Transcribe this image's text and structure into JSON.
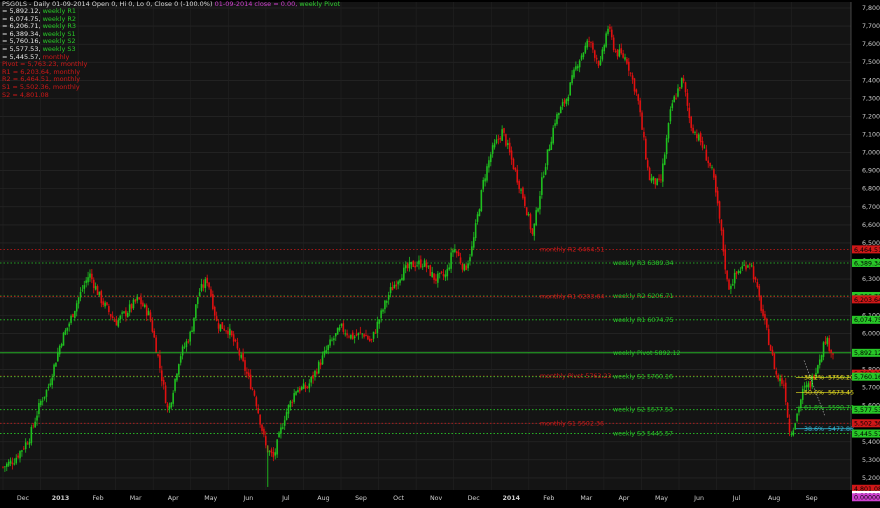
{
  "header": {
    "symbol_line": "PSG0LS - Daily 01-09-2014 Open 0, Hi 0, Lo 0, Close 0 (-100.0%)",
    "close_line": "01-09-2014 close = 0.00,",
    "pivot_line": "weekly Pivot"
  },
  "legend": [
    {
      "value": "= 5,892.12,",
      "label": "weekly R1",
      "color": "#28c828"
    },
    {
      "value": "= 6,074.75,",
      "label": "weekly R2",
      "color": "#28c828"
    },
    {
      "value": "= 6,206.71,",
      "label": "weekly R3",
      "color": "#28c828"
    },
    {
      "value": "= 6,389.34,",
      "label": "weekly S1",
      "color": "#28c828"
    },
    {
      "value": "= 5,760.16,",
      "label": "weekly S2",
      "color": "#28c828"
    },
    {
      "value": "= 5,577.53,",
      "label": "weekly S3",
      "color": "#28c828"
    },
    {
      "value": "= 5,445.57,",
      "label": "monthly",
      "color": "#d01818"
    },
    {
      "value": "Pivot = 5,763.23,",
      "label": "monthly",
      "color": "#d01818"
    },
    {
      "value": "R1 = 6,203.64,",
      "label": "monthly",
      "color": "#d01818"
    },
    {
      "value": "R2 = 6,464.51,",
      "label": "monthly",
      "color": "#d01818"
    },
    {
      "value": "S1 = 5,502.36,",
      "label": "monthly",
      "color": "#d01818"
    },
    {
      "value": "S2 = 4,801.08",
      "label": "",
      "color": "#d01818"
    }
  ],
  "chart_data": {
    "type": "candlestick",
    "ylim": [
      5100,
      7800
    ],
    "y_ticks": [
      "5,200",
      "5,300",
      "5,400",
      "5,500",
      "5,600",
      "5,700",
      "5,800",
      "5,900",
      "6,000",
      "6,100",
      "6,200",
      "6,300",
      "6,400",
      "6,500",
      "6,600",
      "6,700",
      "6,800",
      "6,900",
      "7,000",
      "7,100",
      "7,200",
      "7,300",
      "7,400",
      "7,500",
      "7,600",
      "7,700",
      "7,800"
    ],
    "x_labels": [
      "Dec",
      "2013",
      "Feb",
      "Mar",
      "Apr",
      "May",
      "Jun",
      "Jul",
      "Aug",
      "Sep",
      "Oct",
      "Nov",
      "Dec",
      "2014",
      "Feb",
      "Mar",
      "Apr",
      "May",
      "Jun",
      "Jul",
      "Aug",
      "Sep"
    ],
    "bold_x_labels": [
      "2013",
      "2014"
    ],
    "price_path": [
      [
        0,
        5260
      ],
      [
        0.3,
        5300
      ],
      [
        0.7,
        5420
      ],
      [
        1.0,
        5620
      ],
      [
        1.2,
        5700
      ],
      [
        1.55,
        5960
      ],
      [
        1.75,
        6050
      ],
      [
        2.0,
        6190
      ],
      [
        2.3,
        6330
      ],
      [
        2.6,
        6190
      ],
      [
        3.0,
        6060
      ],
      [
        3.3,
        6120
      ],
      [
        3.6,
        6190
      ],
      [
        3.9,
        6100
      ],
      [
        4.1,
        5900
      ],
      [
        4.4,
        5560
      ],
      [
        4.7,
        5870
      ],
      [
        5.0,
        6000
      ],
      [
        5.2,
        6220
      ],
      [
        5.45,
        6300
      ],
      [
        5.7,
        6050
      ],
      [
        6.0,
        6020
      ],
      [
        6.3,
        5880
      ],
      [
        6.7,
        5660
      ],
      [
        7.0,
        5370
      ],
      [
        7.2,
        5310
      ],
      [
        7.5,
        5540
      ],
      [
        7.8,
        5690
      ],
      [
        8.1,
        5700
      ],
      [
        8.4,
        5820
      ],
      [
        8.7,
        5940
      ],
      [
        9.0,
        6030
      ],
      [
        9.3,
        5980
      ],
      [
        9.6,
        6000
      ],
      [
        9.8,
        5950
      ],
      [
        10.0,
        6070
      ],
      [
        10.3,
        6230
      ],
      [
        10.6,
        6330
      ],
      [
        10.9,
        6380
      ],
      [
        11.2,
        6390
      ],
      [
        11.5,
        6300
      ],
      [
        11.8,
        6320
      ],
      [
        12.0,
        6480
      ],
      [
        12.3,
        6350
      ],
      [
        12.5,
        6480
      ],
      [
        12.8,
        6850
      ],
      [
        13.0,
        7000
      ],
      [
        13.3,
        7120
      ],
      [
        13.6,
        6920
      ],
      [
        13.9,
        6720
      ],
      [
        14.1,
        6540
      ],
      [
        14.4,
        6900
      ],
      [
        14.7,
        7180
      ],
      [
        15.0,
        7300
      ],
      [
        15.3,
        7500
      ],
      [
        15.6,
        7620
      ],
      [
        15.9,
        7480
      ],
      [
        16.1,
        7700
      ],
      [
        16.3,
        7560
      ],
      [
        16.6,
        7520
      ],
      [
        16.9,
        7300
      ],
      [
        17.2,
        6860
      ],
      [
        17.5,
        6820
      ],
      [
        17.8,
        7260
      ],
      [
        18.1,
        7410
      ],
      [
        18.3,
        7160
      ],
      [
        18.6,
        7050
      ],
      [
        18.9,
        6880
      ],
      [
        19.1,
        6600
      ],
      [
        19.3,
        6250
      ],
      [
        19.6,
        6350
      ],
      [
        19.9,
        6400
      ],
      [
        20.1,
        6220
      ],
      [
        20.4,
        5950
      ],
      [
        20.6,
        5760
      ],
      [
        20.8,
        5720
      ],
      [
        20.95,
        5440
      ],
      [
        21.1,
        5520
      ],
      [
        21.3,
        5680
      ],
      [
        21.5,
        5720
      ],
      [
        21.7,
        5840
      ],
      [
        21.9,
        5970
      ],
      [
        22.1,
        5890
      ]
    ],
    "price_path_notes": "x is month index from Dec 2012 (0) to Sep 2014 (22); y is index value",
    "pivot_lines": [
      {
        "value": 6464.51,
        "label": "monthly R2 6464.51",
        "color": "#d01818",
        "style": "dotted",
        "label_pos": "mid-left"
      },
      {
        "value": 6389.34,
        "label": "weekly R3 6389.34",
        "color": "#28c828",
        "style": "dotted",
        "label_pos": "mid-right"
      },
      {
        "value": 6206.71,
        "label": "weekly R2 6206.71",
        "color": "#28c828",
        "style": "dotted",
        "label_pos": "mid-right"
      },
      {
        "value": 6203.64,
        "label": "monthly R1 6203.64",
        "color": "#d01818",
        "style": "dotted",
        "label_pos": "mid-left"
      },
      {
        "value": 6074.75,
        "label": "weekly R1  6074.75",
        "color": "#28c828",
        "style": "dotted",
        "label_pos": "mid-right"
      },
      {
        "value": 5892.12,
        "label": "weekly Pivot  5892.12",
        "color": "#28c828",
        "style": "solid",
        "label_pos": "mid-right"
      },
      {
        "value": 5763.23,
        "label": "monthly Pivot 5763.23",
        "color": "#d01818",
        "style": "dotted",
        "label_pos": "mid-left"
      },
      {
        "value": 5760.16,
        "label": "weekly S1 5760.16",
        "color": "#28c828",
        "style": "dotted",
        "label_pos": "mid-right"
      },
      {
        "value": 5577.53,
        "label": "weekly S2 5577.53",
        "color": "#28c828",
        "style": "dotted",
        "label_pos": "mid-right"
      },
      {
        "value": 5502.36,
        "label": "monthly S1 5502.36",
        "color": "#d01818",
        "style": "dotted",
        "label_pos": "mid-left"
      },
      {
        "value": 5445.57,
        "label": "weekly S3 5445.57",
        "color": "#28c828",
        "style": "dotted",
        "label_pos": "mid-right"
      }
    ],
    "fib_levels": [
      {
        "pct": "38.2%",
        "value": "5756.20",
        "color": "#e8e020"
      },
      {
        "pct": "50.0%",
        "value": "5673.45",
        "color": "#e8e020"
      },
      {
        "pct": "61.8%",
        "value": "5590.70",
        "color": "#28c828"
      },
      {
        "pct": "38.6%",
        "value": "5472.88",
        "color": "#30c0e0"
      }
    ],
    "axis_tags": [
      {
        "text": "6,464.51",
        "value": 6464.51,
        "bg": "#d01818",
        "fg": "#000"
      },
      {
        "text": "6,389.34",
        "value": 6389.34,
        "bg": "#28c828",
        "fg": "#000"
      },
      {
        "text": "6,206.71",
        "value": 6206.71,
        "bg": "#28c828",
        "fg": "#000"
      },
      {
        "text": "6,203.64",
        "value": 6188.0,
        "bg": "#d01818",
        "fg": "#000"
      },
      {
        "text": "6,074.75",
        "value": 6074.75,
        "bg": "#28c828",
        "fg": "#000"
      },
      {
        "text": "5,892.12",
        "value": 5892.12,
        "bg": "#28c828",
        "fg": "#000"
      },
      {
        "text": "5,763.23",
        "value": 5777.0,
        "bg": "#d01818",
        "fg": "#000"
      },
      {
        "text": "5,760.16",
        "value": 5760.16,
        "bg": "#28c828",
        "fg": "#000"
      },
      {
        "text": "5,577.53",
        "value": 5577.53,
        "bg": "#28c828",
        "fg": "#000"
      },
      {
        "text": "5,502.36",
        "value": 5502.36,
        "bg": "#d01818",
        "fg": "#000"
      },
      {
        "text": "5,445.57",
        "value": 5445.57,
        "bg": "#28c828",
        "fg": "#000"
      },
      {
        "text": "4,801.08",
        "value": 5140,
        "bg": "#d01818",
        "fg": "#000"
      },
      {
        "text": "0.00000",
        "value": 5106,
        "bg": "#ffffff",
        "fg": "#000"
      },
      {
        "text": "0.00000",
        "value": 5093,
        "bg": "#d040d0",
        "fg": "#000"
      }
    ],
    "colors": {
      "up": "#1fc01f",
      "down": "#e01010",
      "background": "#000000",
      "grid": "#2a2a2a"
    },
    "grid": true
  }
}
